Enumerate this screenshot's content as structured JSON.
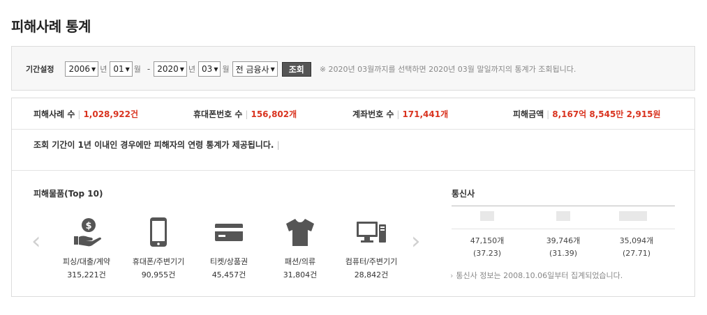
{
  "page": {
    "title": "피해사례 통계"
  },
  "filter": {
    "label": "기간설정",
    "start_year": "2006",
    "start_month": "01",
    "end_year": "2020",
    "end_month": "03",
    "year_unit": "년",
    "month_unit": "월",
    "dash": "-",
    "institution": "전 금융사",
    "search_label": "조회",
    "note": "※ 2020년 03월까지를 선택하면 2020년 03월 말일까지의 통계가 조회됩니다."
  },
  "summary": [
    {
      "label": "피해사례 수",
      "value": "1,028,922건"
    },
    {
      "label": "휴대폰번호 수",
      "value": "156,802개"
    },
    {
      "label": "계좌번호 수",
      "value": "171,441개"
    },
    {
      "label": "피해금액",
      "value": "8,167억 8,545만 2,915원"
    }
  ],
  "age_note": "조회 기간이 1년 이내인 경우에만 피해자의 연령 통계가 제공됩니다.",
  "items": {
    "title": "피해물품(Top 10)",
    "list": [
      {
        "icon": "money-hand-icon",
        "name": "피싱/대출/계약",
        "count": "315,221건"
      },
      {
        "icon": "smartphone-icon",
        "name": "휴대폰/주변기기",
        "count": "90,955건"
      },
      {
        "icon": "card-icon",
        "name": "티켓/상품권",
        "count": "45,457건"
      },
      {
        "icon": "tshirt-icon",
        "name": "패션/의류",
        "count": "31,804건"
      },
      {
        "icon": "computer-icon",
        "name": "컴퓨터/주변기기",
        "count": "28,842건"
      }
    ]
  },
  "carriers": {
    "title": "통신사",
    "list": [
      {
        "count": "47,150개",
        "percent": "(37.23)"
      },
      {
        "count": "39,746개",
        "percent": "(31.39)"
      },
      {
        "count": "35,094개",
        "percent": "(27.71)"
      }
    ],
    "note": "통신사 정보는 2008.10.06일부터 집계되었습니다."
  },
  "colors": {
    "accent_red": "#d9331f",
    "icon_gray": "#555555",
    "button": "#555555"
  }
}
